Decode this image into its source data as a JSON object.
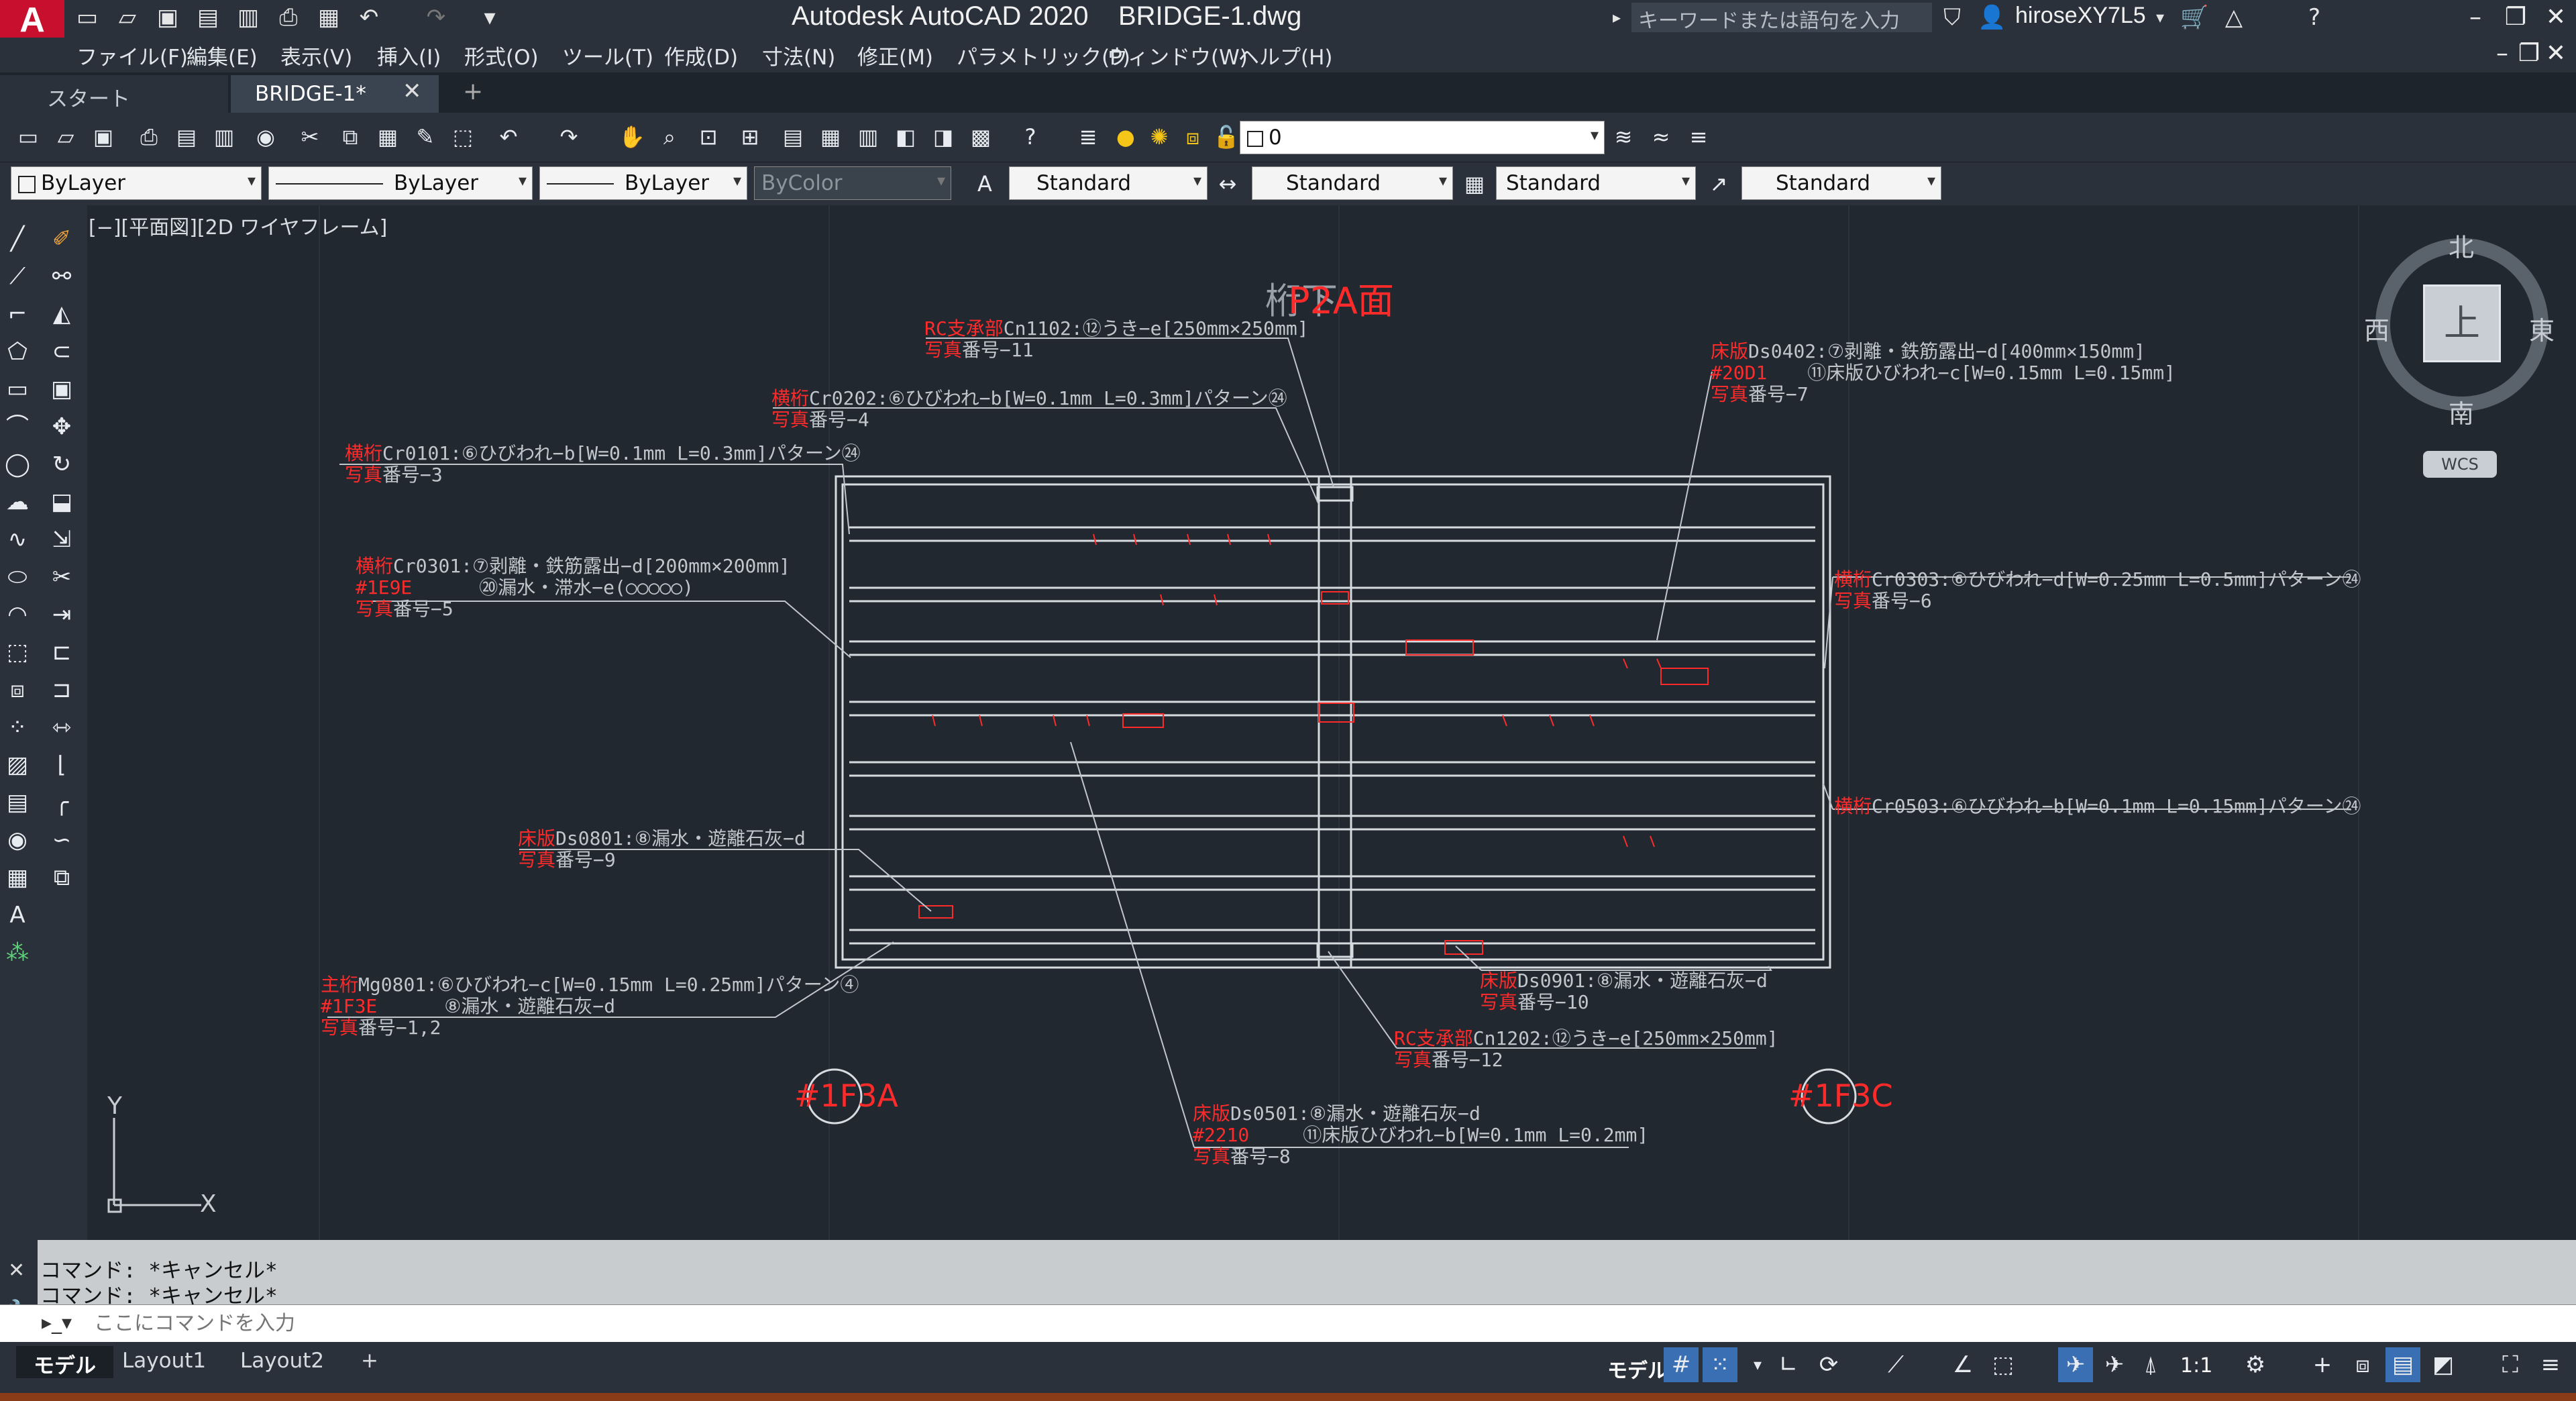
{
  "title_bar": {
    "app_title": "Autodesk AutoCAD 2020    BRIDGE-1.dwg",
    "search_placeholder": "キーワードまたは語句を入力",
    "user_name": "hiroseXY7L5",
    "logo_letter": "A"
  },
  "menu": {
    "items": [
      "ファイル(F)",
      "編集(E)",
      "表示(V)",
      "挿入(I)",
      "形式(O)",
      "ツール(T)",
      "作成(D)",
      "寸法(N)",
      "修正(M)",
      "パラメトリック(P)",
      "ウィンドウ(W)",
      "ヘルプ(H)"
    ]
  },
  "tabs": {
    "start": "スタート",
    "drawing": "BRIDGE-1*"
  },
  "toolbar": {
    "layer_value": "0",
    "color_value": "ByLayer",
    "linetype_value": "ByLayer",
    "lineweight_value": "ByLayer",
    "plotstyle_value": "ByColor",
    "text_style": "Standard",
    "dim_style": "Standard",
    "table_style": "Standard",
    "mleader_style": "Standard"
  },
  "viewport": {
    "label": "[−][平面図][2D ワイヤフレーム]"
  },
  "drawing": {
    "title_a": "桁下",
    "title_b": "P2A面",
    "marker_left": "#1F3A",
    "marker_right": "#1F3C",
    "axis_x": "X",
    "axis_y": "Y",
    "annotations": [
      {
        "r1": "RC支承部",
        "g1": "Cn1102:⑫うき−e[250mm×250mm]",
        "r2": "",
        "g2": "",
        "r3": "写真",
        "g3": "番号−11"
      },
      {
        "r1": "床版",
        "g1": "Ds0402:⑦剥離・鉄筋露出−d[400mm×150mm]",
        "r2": "#20D1",
        "g2": "⑪床版ひびわれ−c[W=0.15mm L=0.15mm]",
        "r3": "写真",
        "g3": "番号−7"
      },
      {
        "r1": "横桁",
        "g1": "Cr0202:⑥ひびわれ−b[W=0.1mm L=0.3mm]パターン㉔",
        "r2": "",
        "g2": "",
        "r3": "写真",
        "g3": "番号−4"
      },
      {
        "r1": "横桁",
        "g1": "Cr0101:⑥ひびわれ−b[W=0.1mm L=0.3mm]パターン㉔",
        "r2": "",
        "g2": "",
        "r3": "写真",
        "g3": "番号−3"
      },
      {
        "r1": "横桁",
        "g1": "Cr0301:⑦剥離・鉄筋露出−d[200mm×200mm]",
        "r2": "#1E9E",
        "g2": "⑳漏水・滞水−e(○○○○○)",
        "r3": "写真",
        "g3": "番号−5"
      },
      {
        "r1": "横桁",
        "g1": "Cr0303:⑥ひびわれ−d[W=0.25mm L=0.5mm]パターン㉔",
        "r2": "",
        "g2": "",
        "r3": "写真",
        "g3": "番号−6"
      },
      {
        "r1": "横桁",
        "g1": "Cr0503:⑥ひびわれ−b[W=0.1mm L=0.15mm]パターン㉔",
        "r2": "",
        "g2": "",
        "r3": "",
        "g3": ""
      },
      {
        "r1": "床版",
        "g1": "Ds0801:⑧漏水・遊離石灰−d",
        "r2": "",
        "g2": "",
        "r3": "写真",
        "g3": "番号−9"
      },
      {
        "r1": "主桁",
        "g1": "Mg0801:⑥ひびわれ−c[W=0.15mm L=0.25mm]パターン④",
        "r2": "#1F3E",
        "g2": "⑧漏水・遊離石灰−d",
        "r3": "写真",
        "g3": "番号−1,2"
      },
      {
        "r1": "床版",
        "g1": "Ds0901:⑧漏水・遊離石灰−d",
        "r2": "",
        "g2": "",
        "r3": "写真",
        "g3": "番号−10"
      },
      {
        "r1": "RC支承部",
        "g1": "Cn1202:⑫うき−e[250mm×250mm]",
        "r2": "",
        "g2": "",
        "r3": "写真",
        "g3": "番号−12"
      },
      {
        "r1": "床版",
        "g1": "Ds0501:⑧漏水・遊離石灰−d",
        "r2": "#2210",
        "g2": "⑪床版ひびわれ−b[W=0.1mm L=0.2mm]",
        "r3": "写真",
        "g3": "番号−8"
      }
    ]
  },
  "viewcube": {
    "top": "上",
    "north": "北",
    "south": "南",
    "east": "東",
    "west": "西",
    "wcs": "WCS"
  },
  "command": {
    "history": [
      "コマンド: *キャンセル*",
      "コマンド: *キャンセル*"
    ],
    "placeholder": "ここにコマンドを入力"
  },
  "status": {
    "layouts": [
      "モデル",
      "Layout1",
      "Layout2"
    ],
    "model_label": "モデル",
    "scale": "1:1"
  }
}
